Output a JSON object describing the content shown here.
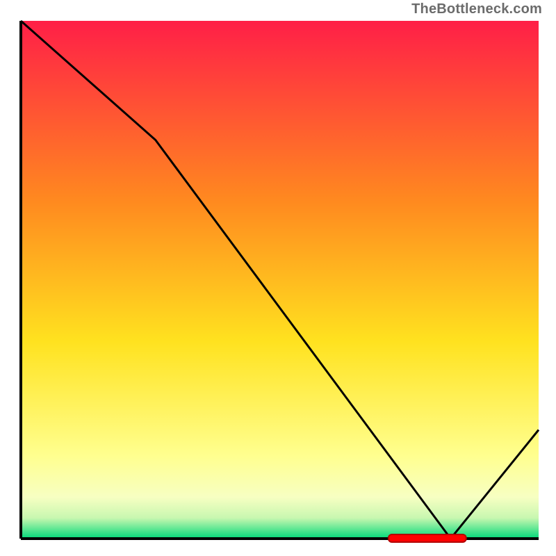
{
  "watermark": "TheBottleneck.com",
  "chart_data": {
    "type": "line",
    "x": [
      0,
      26,
      83,
      100
    ],
    "values": [
      100,
      77,
      0,
      21
    ],
    "title": "",
    "xlabel": "",
    "ylabel": "",
    "xlim": [
      0,
      100
    ],
    "ylim": [
      0,
      100
    ],
    "marker": {
      "start_x": 71,
      "end_x": 86,
      "y": 0
    },
    "colors": {
      "top": "#ff1f47",
      "mid_upper": "#ff8a1f",
      "mid": "#ffe21f",
      "mid_lower": "#ffff8f",
      "band": "#f7ffc2",
      "green_top": "#c8f7b0",
      "green_bottom": "#00d97a",
      "line": "#000000",
      "marker_inner": "#ff0000",
      "marker_border": "#b30000",
      "axis": "#000000"
    }
  }
}
